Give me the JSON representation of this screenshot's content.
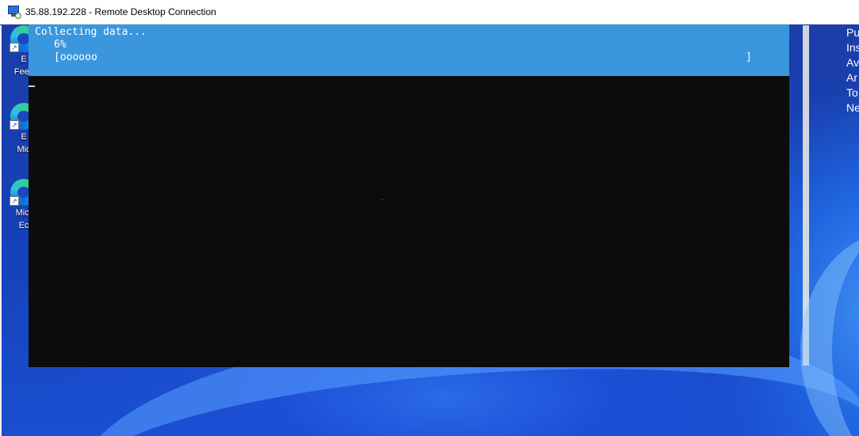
{
  "window": {
    "title": "35.88.192.228 - Remote Desktop Connection"
  },
  "desktop": {
    "icons": [
      {
        "line1": "E",
        "line2": "Feec"
      },
      {
        "line1": "E",
        "line2": "Mic"
      },
      {
        "line1": "Micr",
        "line2": "Ec"
      }
    ],
    "right_panel_lines": [
      "Pu",
      "Ins",
      "Av",
      "Ar",
      "To",
      "Ne"
    ]
  },
  "console": {
    "status_text": "Collecting data...",
    "percent": "6%",
    "progress_open": "[",
    "progress_fill": "oooooo",
    "progress_close": "]",
    "progress_value": 0.06
  }
}
